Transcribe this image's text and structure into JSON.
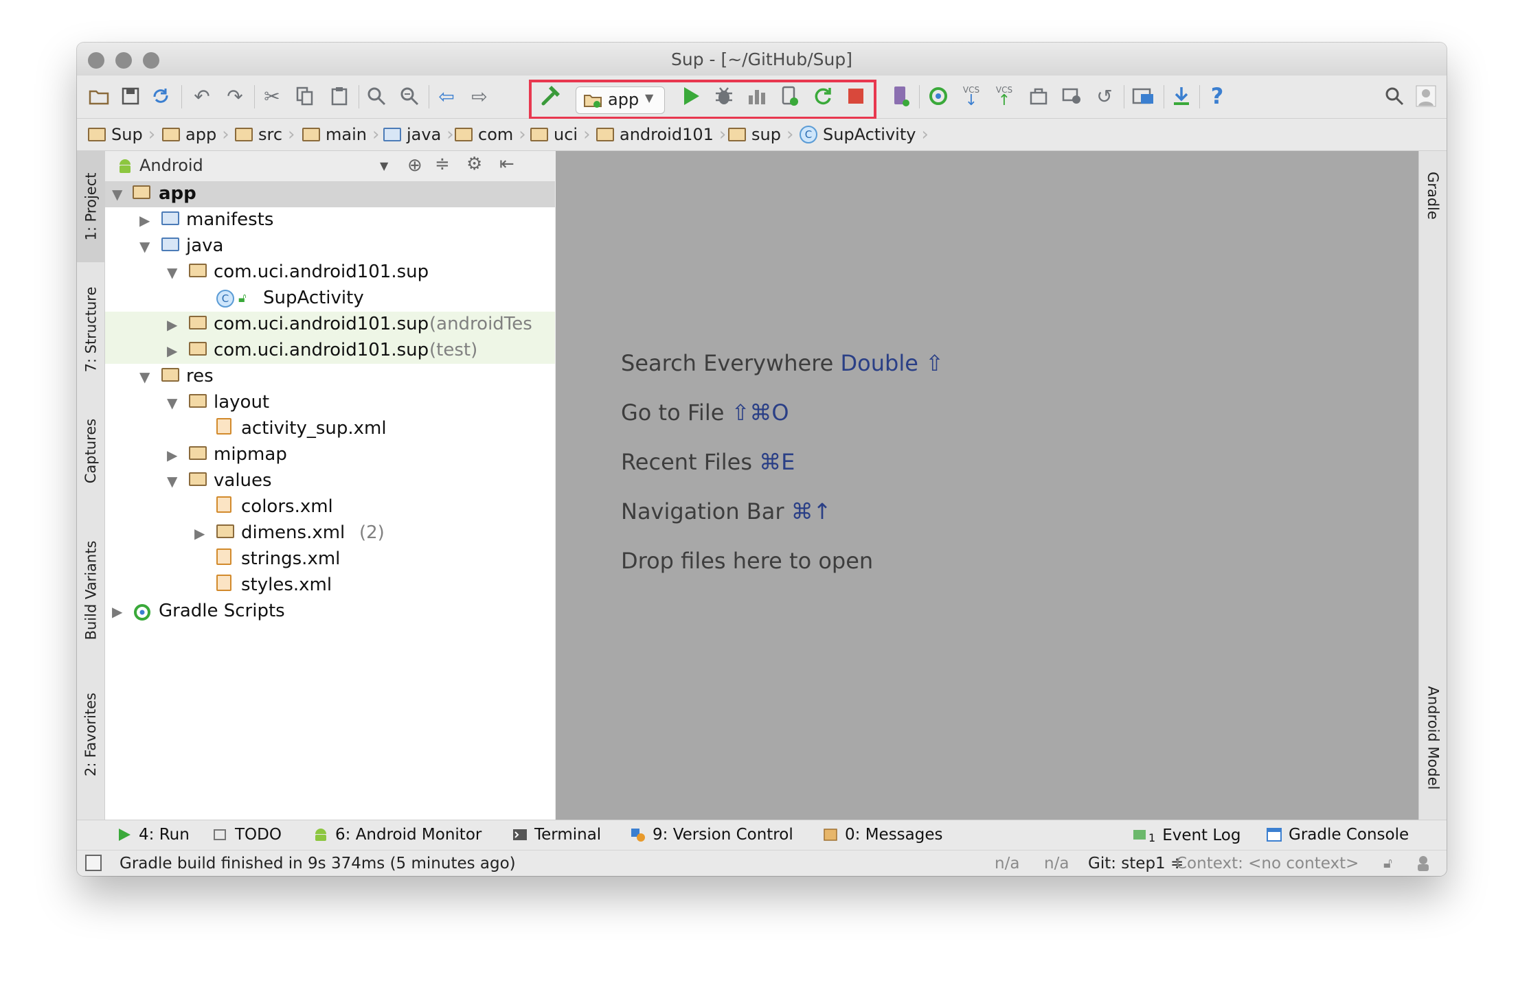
{
  "window": {
    "title": "Sup - [~/GitHub/Sup]"
  },
  "toolbar": {
    "run_config": "app",
    "vcs_label_1": "VCS",
    "vcs_label_2": "VCS",
    "help_icon": "?"
  },
  "breadcrumbs": [
    "Sup",
    "app",
    "src",
    "main",
    "java",
    "com",
    "uci",
    "android101",
    "sup",
    "SupActivity"
  ],
  "project_panel": {
    "view_selector": "Android"
  },
  "tree": [
    {
      "label": "app",
      "muted": ""
    },
    {
      "label": "manifests",
      "muted": ""
    },
    {
      "label": "java",
      "muted": ""
    },
    {
      "label": "com.uci.android101.sup",
      "muted": ""
    },
    {
      "label": "SupActivity",
      "muted": ""
    },
    {
      "label": "com.uci.android101.sup",
      "muted": "(androidTes"
    },
    {
      "label": "com.uci.android101.sup",
      "muted": "(test)"
    },
    {
      "label": "res",
      "muted": ""
    },
    {
      "label": "layout",
      "muted": ""
    },
    {
      "label": "activity_sup.xml",
      "muted": ""
    },
    {
      "label": "mipmap",
      "muted": ""
    },
    {
      "label": "values",
      "muted": ""
    },
    {
      "label": "colors.xml",
      "muted": ""
    },
    {
      "label": "dimens.xml",
      "muted": "(2)"
    },
    {
      "label": "strings.xml",
      "muted": ""
    },
    {
      "label": "styles.xml",
      "muted": ""
    },
    {
      "label": "Gradle Scripts",
      "muted": ""
    }
  ],
  "editor_hints": [
    {
      "text": "Search Everywhere",
      "key": "Double ⇧"
    },
    {
      "text": "Go to File",
      "key": "⇧⌘O"
    },
    {
      "text": "Recent Files",
      "key": "⌘E"
    },
    {
      "text": "Navigation Bar",
      "key": "⌘↑"
    },
    {
      "text": "Drop files here to open",
      "key": ""
    }
  ],
  "left_tabs": [
    "1: Project",
    "7: Structure",
    "Captures",
    "Build Variants",
    "2: Favorites"
  ],
  "right_tabs": [
    "Gradle",
    "Android Model"
  ],
  "bottom_tabs": [
    "4: Run",
    "TODO",
    "6: Android Monitor",
    "Terminal",
    "9: Version Control",
    "0: Messages",
    "Event Log",
    "Gradle Console"
  ],
  "event_log_count": "1",
  "status": {
    "message": "Gradle build finished in 9s 374ms (5 minutes ago)",
    "na1": "n/a",
    "na2": "n/a",
    "git": "Git: step1 ≑",
    "context": "Context: <no context>"
  }
}
